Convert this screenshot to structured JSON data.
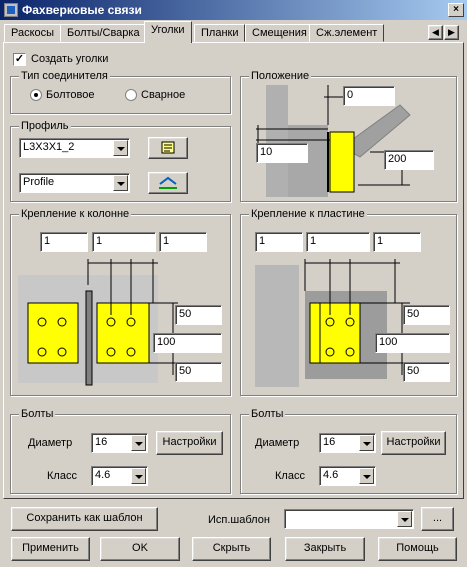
{
  "window": {
    "title": "Фахверковые связи"
  },
  "tabs": [
    "Раскосы",
    "Болты/Сварка",
    "Уголки",
    "Планки",
    "Смещения",
    "Сж.элемент"
  ],
  "active_tab": "Уголки",
  "create_angles": {
    "label": "Создать уголки",
    "checked": true
  },
  "connector_type": {
    "title": "Тип соединителя",
    "options": [
      "Болтовое",
      "Сварное"
    ],
    "selected": "Болтовое"
  },
  "profile": {
    "title": "Профиль",
    "profile_value": "L3X3X1_2",
    "type_value": "Profile"
  },
  "position": {
    "title": "Положение",
    "top_value": "0",
    "left_value": "10",
    "right_value": "200"
  },
  "column_attach": {
    "title": "Крепление к колонне",
    "top_values": [
      "1",
      "1",
      "1"
    ],
    "side_values": [
      "50",
      "100",
      "50"
    ]
  },
  "plate_attach": {
    "title": "Крепление к пластине",
    "top_values": [
      "1",
      "1",
      "1"
    ],
    "side_values": [
      "50",
      "100",
      "50"
    ]
  },
  "bolts_left": {
    "title": "Болты",
    "diameter_label": "Диаметр",
    "diameter": "16",
    "class_label": "Класс",
    "class_value": "4.6",
    "settings_label": "Настройки"
  },
  "bolts_right": {
    "title": "Болты",
    "diameter_label": "Диаметр",
    "diameter": "16",
    "class_label": "Класс",
    "class_value": "4.6",
    "settings_label": "Настройки"
  },
  "template": {
    "save_label": "Сохранить как шаблон",
    "use_label": "Исп.шаблон",
    "use_value": "",
    "browse_label": "..."
  },
  "footer": {
    "apply": "Применить",
    "ok": "OK",
    "hide": "Скрыть",
    "close": "Закрыть",
    "help": "Помощь"
  }
}
